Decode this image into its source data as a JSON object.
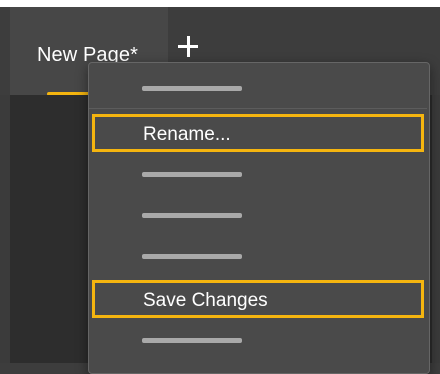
{
  "tabs": [
    {
      "label": "New Page*",
      "active": true
    }
  ],
  "add_tab_icon": "plus-icon",
  "accent_color": "#f5b50f",
  "menu": {
    "items": [
      {
        "type": "placeholder"
      },
      {
        "label": "Rename...",
        "highlighted": true
      },
      {
        "type": "placeholder"
      },
      {
        "type": "placeholder"
      },
      {
        "type": "placeholder"
      },
      {
        "label": "Save Changes",
        "highlighted": true
      },
      {
        "type": "placeholder"
      }
    ]
  }
}
